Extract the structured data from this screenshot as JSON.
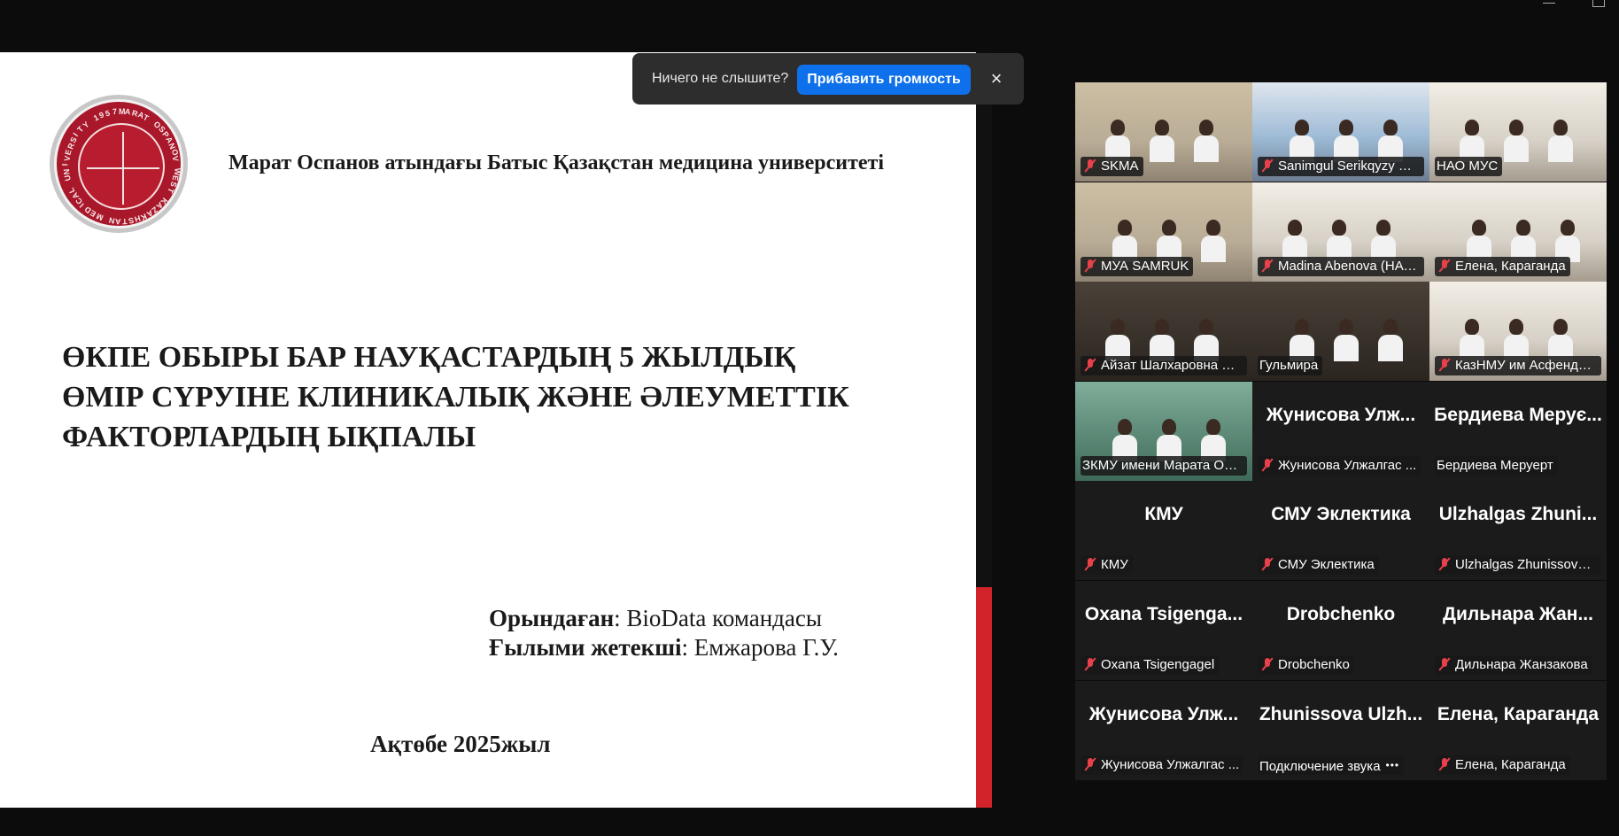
{
  "window": {
    "controls": {
      "minimize_icon": "minimize-icon",
      "restore_icon": "restore-icon"
    }
  },
  "slide": {
    "seal_text": "MARAT OSPANOV WEST KAZAKHSTAN MEDICAL UNIVERSITY 1957",
    "university": "Марат Оспанов атындағы Батыс Қазақстан медицина университеті",
    "title_lines": [
      "ӨКПЕ ОБЫРЫ БАР НАУҚАСТАРДЫҢ 5 ЖЫЛДЫҚ",
      "ӨМІР СҮРУІНЕ КЛИНИКАЛЫҚ ЖӘНЕ ӘЛЕУМЕТТІК",
      "ФАКТОРЛАРДЫҢ ЫҚПАЛЫ"
    ],
    "performed_label": "Орындаған",
    "performed_value": ": BioData командасы",
    "advisor_label": "Ғылыми жетекші",
    "advisor_value": ": Емжарова Г.У.",
    "city_year": "Ақтөбе 2025жыл"
  },
  "toast": {
    "message": "Ничего не слышите?",
    "action_label": "Прибавить громкость",
    "close_label": "×"
  },
  "gallery": {
    "tiles": [
      {
        "label": "SKMA",
        "muted": true,
        "type": "video"
      },
      {
        "label": "Sanimgul Serikqyzy Sa...",
        "muted": true,
        "type": "video"
      },
      {
        "label": "НАО МУС",
        "muted": false,
        "type": "video"
      },
      {
        "label": "МУА SAMRUK",
        "muted": true,
        "type": "video"
      },
      {
        "label": "Madina Abenova (НАО...",
        "muted": true,
        "type": "video"
      },
      {
        "label": "Елена, Караганда",
        "muted": true,
        "type": "video"
      },
      {
        "label": "Айзат Шалхаровна Ай...",
        "muted": true,
        "type": "video"
      },
      {
        "label": "Гульмира",
        "muted": false,
        "type": "video"
      },
      {
        "label": "КазНМУ им Асфендия...",
        "muted": true,
        "type": "video"
      },
      {
        "label": "ЗКМУ имени Марата Осп...",
        "muted": false,
        "type": "video"
      },
      {
        "label": "Жунисова Улжалгас ...",
        "name_card": "Жунисова Улж...",
        "muted": true,
        "type": "name"
      },
      {
        "label": "Бердиева Меруерт",
        "name_card": "Бердиева Мерує...",
        "muted": false,
        "type": "name",
        "active": true
      },
      {
        "label": "КМУ",
        "name_card": "КМУ",
        "muted": true,
        "type": "name"
      },
      {
        "label": "СМУ Эклектика",
        "name_card": "СМУ Эклектика",
        "muted": true,
        "type": "name"
      },
      {
        "label": "Ulzhalgas Zhunissova ...",
        "name_card": "Ulzhalgas Zhuni...",
        "muted": true,
        "type": "name"
      },
      {
        "label": "Oxana Tsigengagel",
        "name_card": "Oxana Tsigenga...",
        "muted": true,
        "type": "name"
      },
      {
        "label": "Drobchenko",
        "name_card": "Drobchenko",
        "muted": true,
        "type": "name"
      },
      {
        "label": "Дильнара Жанзакова",
        "name_card": "Дильнара Жан...",
        "muted": true,
        "type": "name"
      },
      {
        "label": "Жунисова Улжалгас ...",
        "name_card": "Жунисова Улж...",
        "muted": true,
        "type": "name"
      },
      {
        "label": "Подключение звука",
        "name_card": "Zhunissova Ulzh...",
        "muted": false,
        "type": "name",
        "connecting": true
      },
      {
        "label": "Елена, Караганда",
        "name_card": "Елена, Караганда",
        "muted": true,
        "type": "name"
      }
    ]
  },
  "colors": {
    "active_speaker": "#22cc7a",
    "muted_mic": "#e8414b",
    "toast_button": "#0e71eb",
    "slide_accent": "#d2232a"
  }
}
